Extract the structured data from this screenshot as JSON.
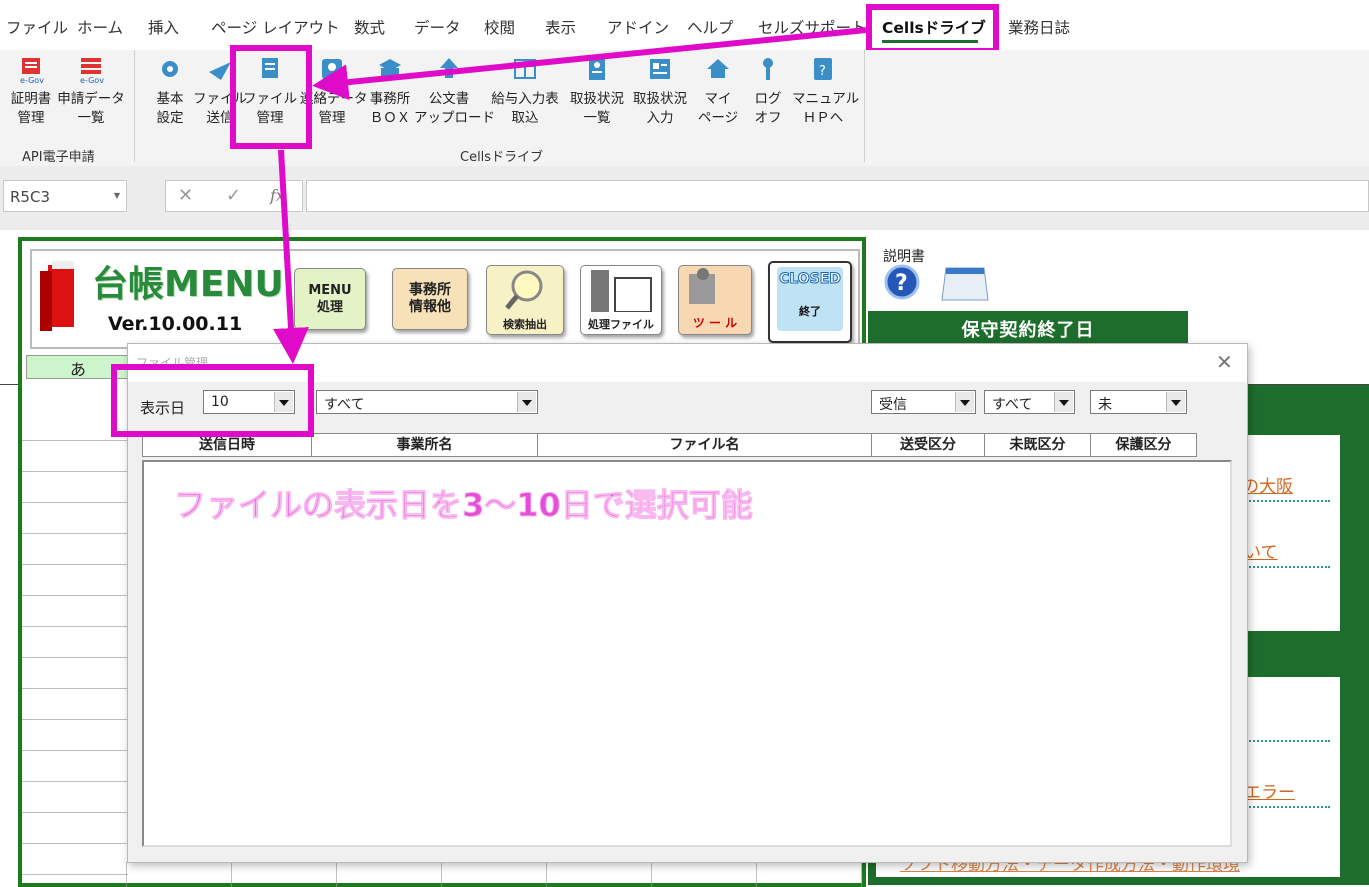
{
  "menubar": {
    "tabs": [
      "ファイル",
      "ホーム",
      "挿入",
      "ページ レイアウト",
      "数式",
      "データ",
      "校閲",
      "表示",
      "アドイン",
      "ヘルプ",
      "セルズサポート",
      "Cellsドライブ",
      "業務日誌"
    ]
  },
  "ribbon": {
    "groups": [
      {
        "label": "API電子申請",
        "buttons": [
          {
            "label": "証明書\n管理",
            "icon": "egov-cert-icon"
          },
          {
            "label": "申請データ\n一覧",
            "icon": "egov-list-icon"
          }
        ]
      },
      {
        "label": "Cellsドライブ",
        "buttons": [
          {
            "label": "基本\n設定",
            "icon": "gear-icon"
          },
          {
            "label": "ファイル\n送信",
            "icon": "send-icon"
          },
          {
            "label": "ファイル\n管理",
            "icon": "file-manage-icon"
          },
          {
            "label": "連絡データ\n管理",
            "icon": "contact-icon"
          },
          {
            "label": "事務所\nＢＯＸ",
            "icon": "box-icon"
          },
          {
            "label": "公文書\nアップロード",
            "icon": "upload-icon"
          },
          {
            "label": "給与入力表\n取込",
            "icon": "table-icon"
          },
          {
            "label": "取扱状況\n一覧",
            "icon": "status-list-icon"
          },
          {
            "label": "取扱状況\n入力",
            "icon": "status-input-icon"
          },
          {
            "label": "マイ\nページ",
            "icon": "home-icon"
          },
          {
            "label": "ログ\nオフ",
            "icon": "key-icon"
          },
          {
            "label": "マニュアル\nＨＰへ",
            "icon": "manual-icon"
          }
        ]
      }
    ]
  },
  "formula_bar": {
    "name_box": "R5C3",
    "fx": "fx"
  },
  "sheet": {
    "logo_title": "台帳MENU",
    "version": "Ver.10.00.11",
    "buttons": {
      "menu": "MENU\n処理",
      "office": "事務所\n情報他",
      "search": "検索抽出",
      "proc_file": "処理ファイル",
      "tool": "ツ ー ル",
      "closed": "CLOSED",
      "closed_sub": "終了"
    },
    "manual_label": "説明書",
    "contract_end": "保守契約終了日",
    "col_a": "あ",
    "links": [
      "の大阪",
      "いて",
      "エラー",
      "ソフト移動方法・データ作成方法・動作環境"
    ]
  },
  "dialog": {
    "title": "ファイル管理",
    "display_days_label": "表示日",
    "display_days_value": "10",
    "office_filter": "すべて",
    "direction": "受信",
    "read_filter": "すべて",
    "protect_filter": "未",
    "columns": [
      "送信日時",
      "事業所名",
      "ファイル名",
      "送受区分",
      "未既区分",
      "保護区分"
    ],
    "annotation": "ファイルの表示日を3～10日で選択可能"
  },
  "colors": {
    "highlight": "#e00bc8",
    "green": "#1d6e2c",
    "annotation": "#e54fd6"
  }
}
